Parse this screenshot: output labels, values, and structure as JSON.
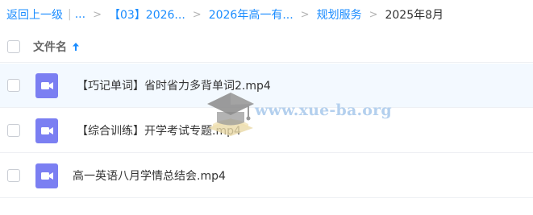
{
  "breadcrumb": {
    "back_label": "返回上一级",
    "ellipsis": "...",
    "items": [
      "【03】2026...",
      "2026年高一有...",
      "规划服务"
    ],
    "current": "2025年8月"
  },
  "table": {
    "name_header": "文件名",
    "sort_direction": "ascending",
    "rows": [
      {
        "name": "【巧记单词】省时省力多背单词2.mp4",
        "type": "video"
      },
      {
        "name": "【综合训练】开学考试专题.mp4",
        "type": "video"
      },
      {
        "name": "高一英语八月学情总结会.mp4",
        "type": "video"
      }
    ]
  },
  "watermark": {
    "text": "www.xue-ba.org"
  },
  "colors": {
    "accent": "#1a8cff",
    "video_icon": "#7b7ff2",
    "row_hover": "#f3f9ff",
    "watermark": "#b4d0ee"
  }
}
